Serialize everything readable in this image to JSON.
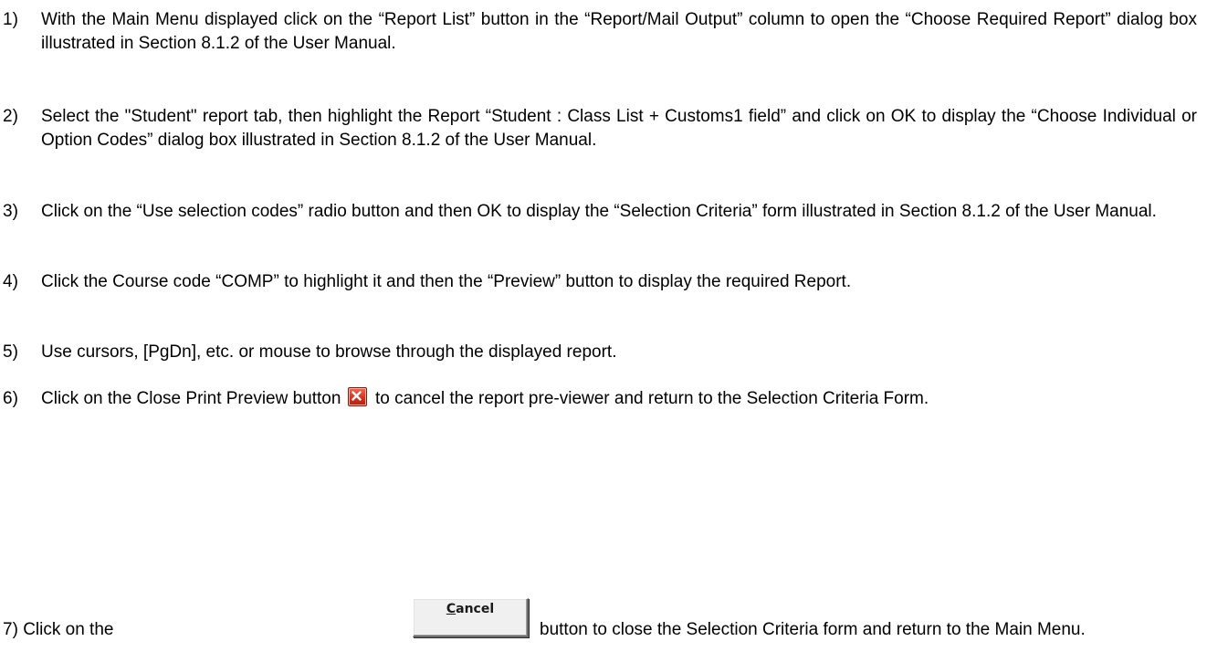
{
  "steps": [
    {
      "number": "1)",
      "text": "With the Main Menu displayed click on the “Report List” button in the “Report/Mail Output” column to open the “Choose Required Report” dialog box illustrated in Section 8.1.2 of the User Manual."
    },
    {
      "number": "2)",
      "text": "Select the \"Student\" report tab, then highlight the Report  “Student : Class List + Customs1 field” and click on OK to display the “Choose Individual or Option Codes” dialog box illustrated in Section 8.1.2 of the User Manual."
    },
    {
      "number": "3)",
      "text": "Click on the “Use selection codes” radio button and then OK to display the “Selection Criteria” form illustrated in Section 8.1.2 of the User Manual."
    },
    {
      "number": "4)",
      "text": "Click the Course code “COMP” to highlight it and then the “Preview” button to display the required Report."
    },
    {
      "number": "5)",
      "text": "Use cursors,  [PgDn], etc. or mouse to browse through the displayed report."
    },
    {
      "number": "6)",
      "text_before_icon": "Click on the Close Print Preview button",
      "icon": "close-print-preview-icon",
      "text_after_icon": "to cancel the report pre-viewer and return to the Selection Criteria Form."
    },
    {
      "number": "7)",
      "text_before_button": "Click on the",
      "button_label_accel": "C",
      "button_label_rest": "ancel",
      "text_after_button": "button to close the Selection Criteria form and return to the Main Menu."
    }
  ],
  "colors": {
    "text": "#000000",
    "close_icon": "#d6321e",
    "button_face": "#f0f0f0"
  }
}
